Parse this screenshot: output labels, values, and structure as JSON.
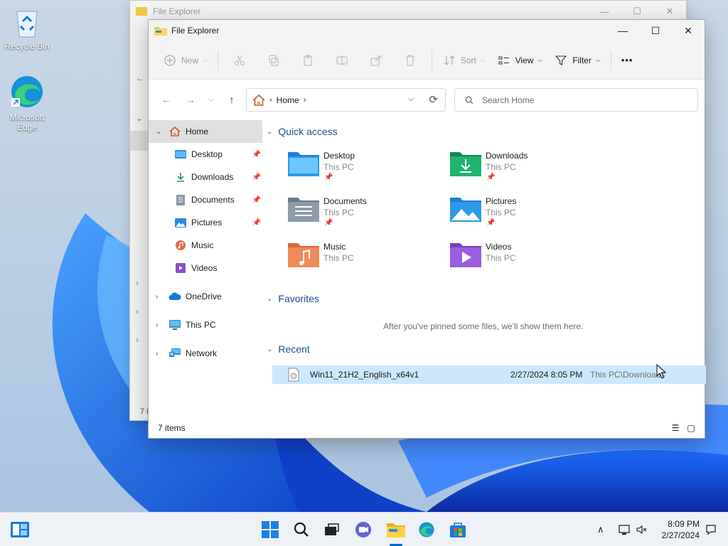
{
  "desktop": {
    "icons": [
      {
        "label": "Recycle Bin"
      },
      {
        "label": "Microsoft Edge"
      }
    ]
  },
  "back_window": {
    "title": "File Explorer",
    "status_items": "7 i"
  },
  "window": {
    "title": "File Explorer",
    "controls": {
      "minimize": "—",
      "maximize": "☐",
      "close": "✕"
    }
  },
  "toolbar": {
    "new_label": "New",
    "sort_label": "Sort",
    "view_label": "View",
    "filter_label": "Filter",
    "more_label": "•••"
  },
  "address": {
    "crumb": "Home"
  },
  "search": {
    "placeholder": "Search Home"
  },
  "nav": {
    "home": "Home",
    "desktop": "Desktop",
    "downloads": "Downloads",
    "documents": "Documents",
    "pictures": "Pictures",
    "music": "Music",
    "videos": "Videos",
    "onedrive": "OneDrive",
    "thispc": "This PC",
    "network": "Network"
  },
  "quick_access": {
    "heading": "Quick access",
    "items": [
      {
        "name": "Desktop",
        "location": "This PC",
        "pinned": true
      },
      {
        "name": "Downloads",
        "location": "This PC",
        "pinned": true
      },
      {
        "name": "Documents",
        "location": "This PC",
        "pinned": true
      },
      {
        "name": "Pictures",
        "location": "This PC",
        "pinned": true
      },
      {
        "name": "Music",
        "location": "This PC",
        "pinned": false
      },
      {
        "name": "Videos",
        "location": "This PC",
        "pinned": false
      }
    ]
  },
  "favorites": {
    "heading": "Favorites",
    "empty_note": "After you've pinned some files, we'll show them here."
  },
  "recent": {
    "heading": "Recent",
    "files": [
      {
        "name": "Win11_21H2_English_x64v1",
        "date": "2/27/2024 8:05 PM",
        "location": "This PC\\Downloads"
      }
    ]
  },
  "status": {
    "items": "7 items"
  },
  "taskbar": {
    "time": "8:09 PM",
    "date": "2/27/2024"
  },
  "colors": {
    "accent": "#0067c0",
    "selection": "#cce8ff",
    "heading": "#1f4e8c"
  }
}
